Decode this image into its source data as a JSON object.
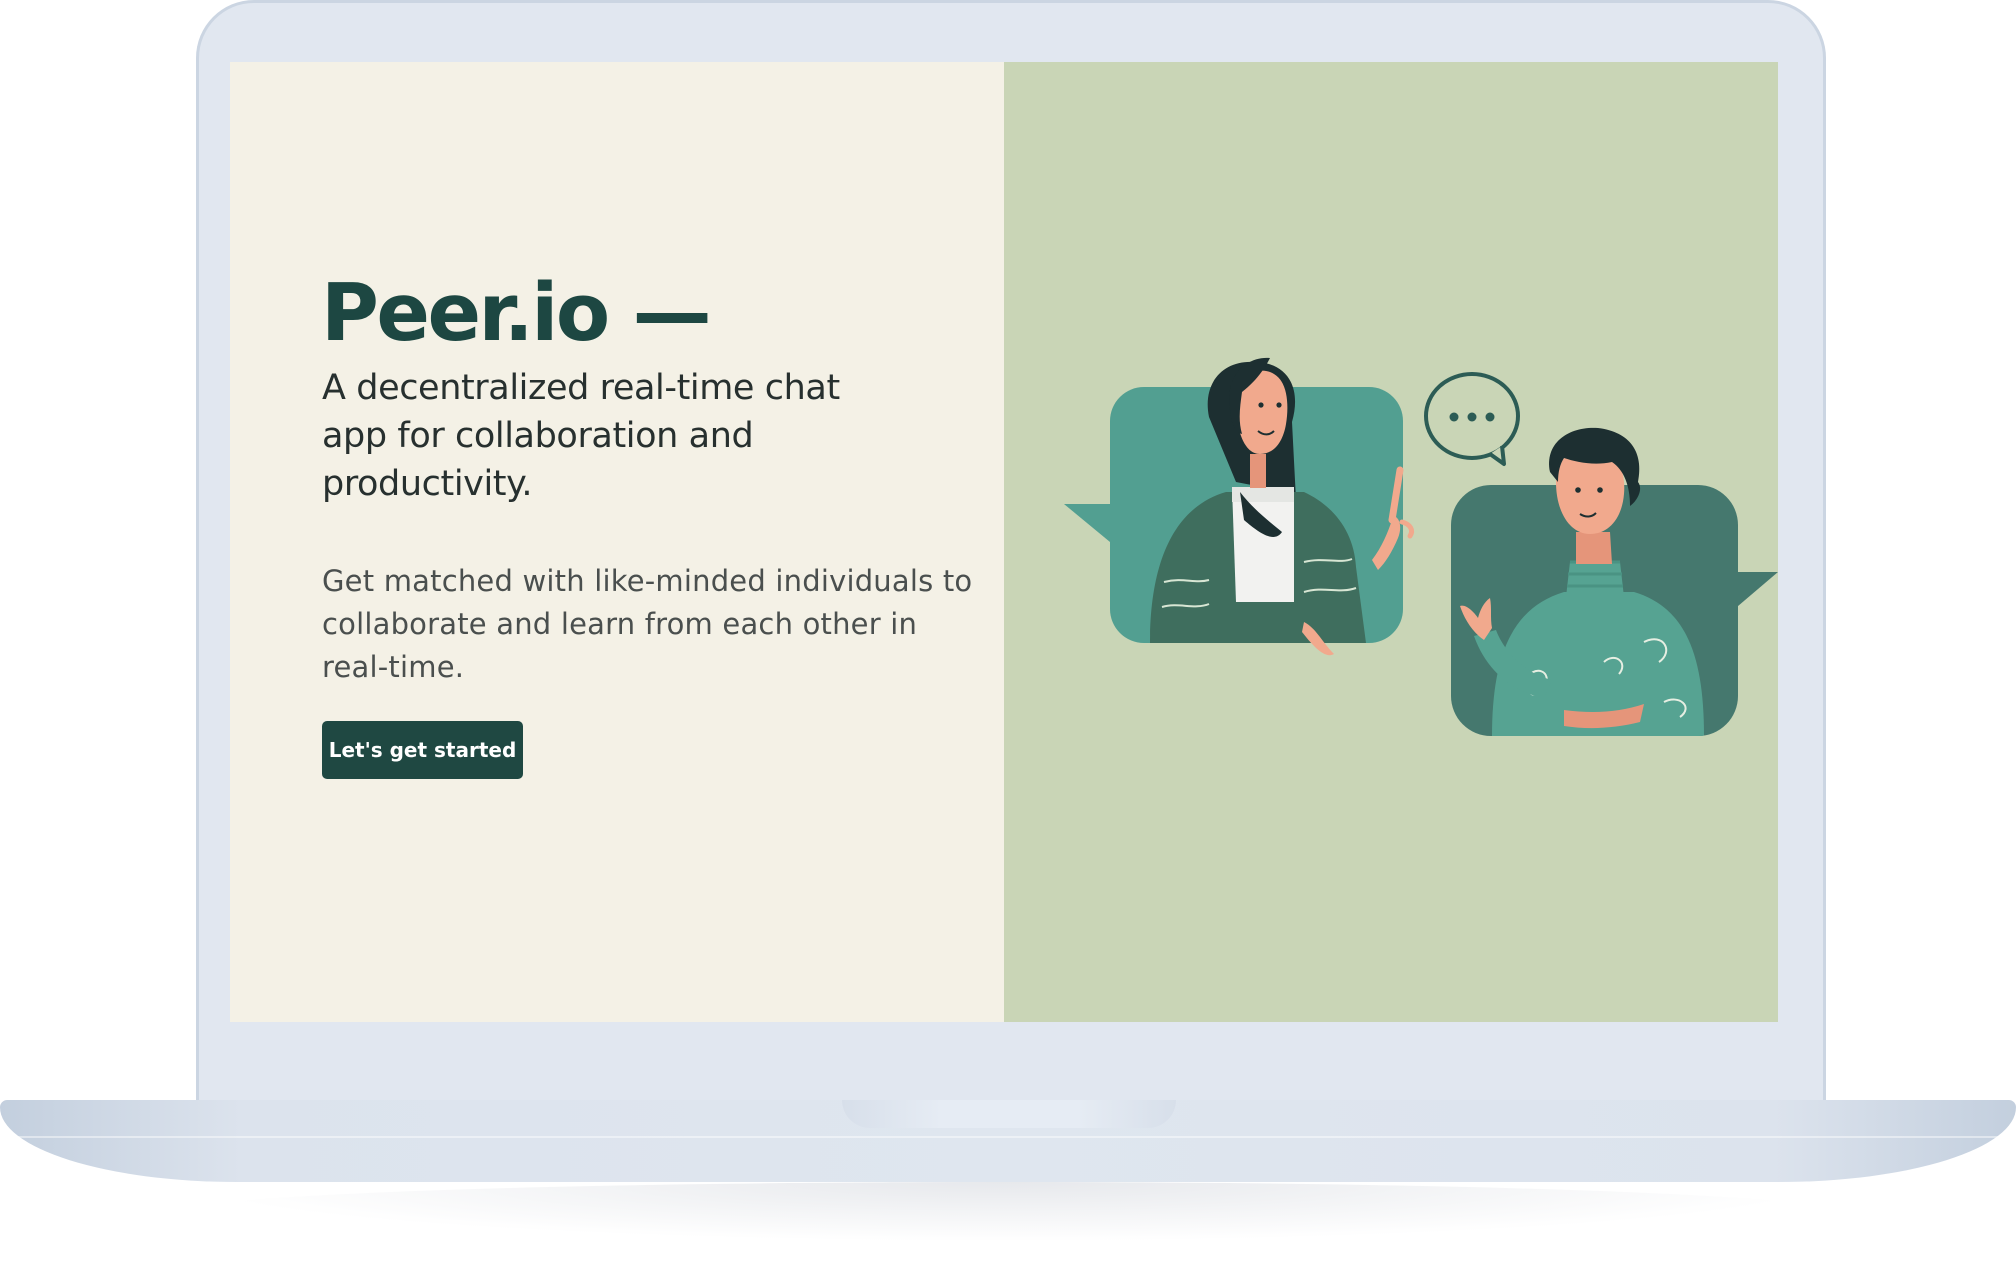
{
  "hero": {
    "title": "Peer.io —",
    "subtitle": "A decentralized real-time chat app for collaboration and productivity.",
    "description": "Get matched with like-minded individuals to collaborate and learn from each other in real-time.",
    "cta_label": "Let's get started"
  },
  "illustration": {
    "bubble_text": "..."
  },
  "colors": {
    "left_panel_bg": "#f4f1e6",
    "right_panel_bg": "#c9d5b6",
    "accent_dark": "#1f4842",
    "teal": "#529f91",
    "teal_dark": "#45786e",
    "device_frame": "#e1e7f0"
  },
  "icons": [
    "speech-bubble-icon",
    "woman-avatar-icon",
    "man-avatar-icon"
  ]
}
